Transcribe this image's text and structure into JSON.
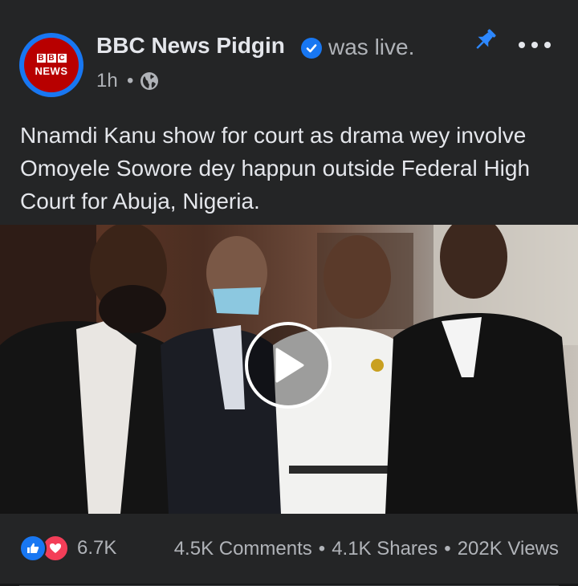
{
  "post": {
    "page_name": "BBC News Pidgin",
    "status": "was live.",
    "time": "1h",
    "separator": "•",
    "avatar": {
      "line1": [
        "B",
        "B",
        "C"
      ],
      "line2": "NEWS"
    },
    "text": "Nnamdi Kanu show for court as drama wey involve Omoyele Sowore dey happun outside Federal High Court for Abuja, Nigeria."
  },
  "engagement": {
    "reaction_count": "6.7K",
    "comments": "4.5K Comments",
    "shares": "4.1K Shares",
    "views": "202K Views",
    "separator": "•"
  },
  "icons": {
    "verified": "verified-badge-icon",
    "privacy": "globe-icon",
    "pin": "pin-icon",
    "more": "more-options-icon",
    "play": "play-icon",
    "like": "like-reaction-icon",
    "love": "love-reaction-icon"
  },
  "colors": {
    "background": "#18191a",
    "card": "#242526",
    "primary_text": "#e4e6eb",
    "secondary_text": "#b0b3b8",
    "accent": "#1877f2",
    "brand_red": "#b80000",
    "love": "#f33e58"
  }
}
